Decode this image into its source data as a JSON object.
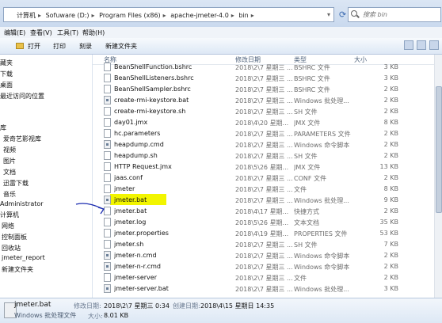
{
  "address": {
    "crumbs": [
      "计算机",
      "Sofuware (D:)",
      "Program Files (x86)",
      "apache-jmeter-4.0",
      "bin"
    ],
    "search_placeholder": "搜索 bin"
  },
  "menu": [
    "编辑(E)",
    "查看(V)",
    "工具(T)",
    "帮助(H)"
  ],
  "toolbar": {
    "open": "打开",
    "print": "打印",
    "burn": "刻录",
    "new_folder": "新建文件夹"
  },
  "sidebar": [
    "藏夹",
    "下载",
    "桌面",
    "最近访问的位置",
    "",
    "库",
    "爱奇艺影视库",
    "视频",
    "图片",
    "文档",
    "迅雷下载",
    "音乐",
    "Administrator",
    "计算机",
    "网络",
    "控制面板",
    "回收站",
    "jmeter_report",
    "新建文件夹"
  ],
  "columns": {
    "name": "名称",
    "date": "修改日期",
    "type": "类型",
    "size": "大小"
  },
  "files": [
    {
      "name": "BeanShellFunction.bshrc",
      "date": "2018\\2\\7 星期三 ...",
      "type": "BSHRC 文件",
      "size": "3 KB",
      "icon": "file"
    },
    {
      "name": "BeanShellListeners.bshrc",
      "date": "2018\\2\\7 星期三 ...",
      "type": "BSHRC 文件",
      "size": "3 KB",
      "icon": "file"
    },
    {
      "name": "BeanShellSampler.bshrc",
      "date": "2018\\2\\7 星期三 ...",
      "type": "BSHRC 文件",
      "size": "2 KB",
      "icon": "file"
    },
    {
      "name": "create-rmi-keystore.bat",
      "date": "2018\\2\\7 星期三 ...",
      "type": "Windows 批处理...",
      "size": "2 KB",
      "icon": "bat"
    },
    {
      "name": "create-rmi-keystore.sh",
      "date": "2018\\2\\7 星期三 ...",
      "type": "SH 文件",
      "size": "2 KB",
      "icon": "file"
    },
    {
      "name": "day01.jmx",
      "date": "2018\\4\\20 星期...",
      "type": "JMX 文件",
      "size": "8 KB",
      "icon": "file"
    },
    {
      "name": "hc.parameters",
      "date": "2018\\2\\7 星期三 ...",
      "type": "PARAMETERS 文件",
      "size": "2 KB",
      "icon": "file"
    },
    {
      "name": "heapdump.cmd",
      "date": "2018\\2\\7 星期三 ...",
      "type": "Windows 命令脚本",
      "size": "2 KB",
      "icon": "bat"
    },
    {
      "name": "heapdump.sh",
      "date": "2018\\2\\7 星期三 ...",
      "type": "SH 文件",
      "size": "2 KB",
      "icon": "file"
    },
    {
      "name": "HTTP Request.jmx",
      "date": "2018\\5\\26 星期...",
      "type": "JMX 文件",
      "size": "13 KB",
      "icon": "file"
    },
    {
      "name": "jaas.conf",
      "date": "2018\\2\\7 星期三 ...",
      "type": "CONF 文件",
      "size": "2 KB",
      "icon": "file"
    },
    {
      "name": "jmeter",
      "date": "2018\\2\\7 星期三 ...",
      "type": "文件",
      "size": "8 KB",
      "icon": "file"
    },
    {
      "name": "jmeter.bat",
      "date": "2018\\2\\7 星期三 ...",
      "type": "Windows 批处理...",
      "size": "9 KB",
      "icon": "bat",
      "selected": true
    },
    {
      "name": "jmeter.bat",
      "date": "2018\\4\\17 星期...",
      "type": "快捷方式",
      "size": "2 KB",
      "icon": "file"
    },
    {
      "name": "jmeter.log",
      "date": "2018\\5\\26 星期...",
      "type": "文本文档",
      "size": "35 KB",
      "icon": "file"
    },
    {
      "name": "jmeter.properties",
      "date": "2018\\4\\19 星期...",
      "type": "PROPERTIES 文件",
      "size": "53 KB",
      "icon": "file"
    },
    {
      "name": "jmeter.sh",
      "date": "2018\\2\\7 星期三 ...",
      "type": "SH 文件",
      "size": "7 KB",
      "icon": "file"
    },
    {
      "name": "jmeter-n.cmd",
      "date": "2018\\2\\7 星期三 ...",
      "type": "Windows 命令脚本",
      "size": "2 KB",
      "icon": "bat"
    },
    {
      "name": "jmeter-n-r.cmd",
      "date": "2018\\2\\7 星期三 ...",
      "type": "Windows 命令脚本",
      "size": "2 KB",
      "icon": "bat"
    },
    {
      "name": "jmeter-server",
      "date": "2018\\2\\7 星期三 ...",
      "type": "文件",
      "size": "2 KB",
      "icon": "file"
    },
    {
      "name": "jmeter-server.bat",
      "date": "2018\\2\\7 星期三 ...",
      "type": "Windows 批处理...",
      "size": "3 KB",
      "icon": "bat"
    }
  ],
  "details": {
    "name": "jmeter.bat",
    "type": "Windows 批处理文件",
    "modified_label": "修改日期:",
    "modified_value": "2018\\2\\7 星期三 0:34",
    "created_label": "创建日期:",
    "created_value": "2018\\4\\15 星期日 14:35",
    "size_label": "大小:",
    "size_value": "8.01 KB"
  },
  "colors": {
    "highlight": "#f2f500",
    "annotation_arrow": "#1a2bb0"
  }
}
